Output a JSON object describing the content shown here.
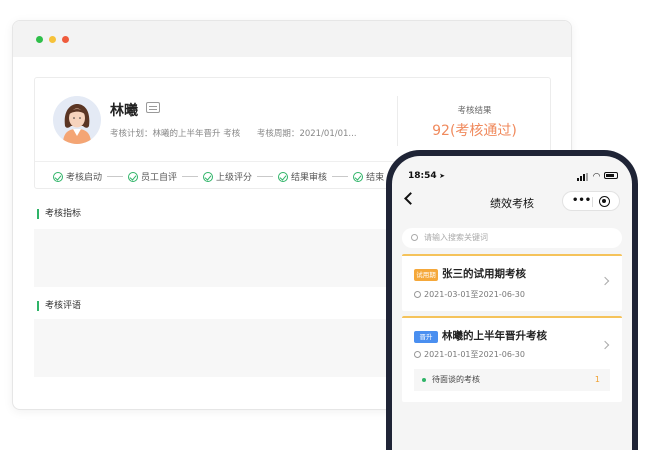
{
  "desktop": {
    "profile": {
      "name": "林曦",
      "plan_label": "考核计划：",
      "plan_value": "林曦的上半年晋升 考核",
      "period_label": "考核周期：",
      "period_value": "2021/01/01..."
    },
    "result": {
      "label": "考核结果",
      "value": "92(考核通过)"
    },
    "steps": [
      "考核启动",
      "员工自评",
      "上级评分",
      "结果审核",
      "结束"
    ],
    "sections": {
      "indicators": "考核指标",
      "comments": "考核评语"
    }
  },
  "mobile": {
    "status_time": "18:54",
    "nav_title": "绩效考核",
    "search_placeholder": "请输入搜索关键词",
    "items": [
      {
        "badge": "试用期",
        "badge_color": "#f5a83a",
        "title": "张三的试用期考核",
        "date": "2021-03-01至2021-06-30"
      },
      {
        "badge": "晋升",
        "badge_color": "#4a8ff0",
        "title": "林曦的上半年晋升考核",
        "date": "2021-01-01至2021-06-30",
        "pending_label": "待面谈的考核",
        "pending_count": "1"
      }
    ]
  },
  "colors": {
    "accent_green": "#2fb468",
    "result_orange": "#f08a5d",
    "phone_frame": "#1f2436"
  }
}
